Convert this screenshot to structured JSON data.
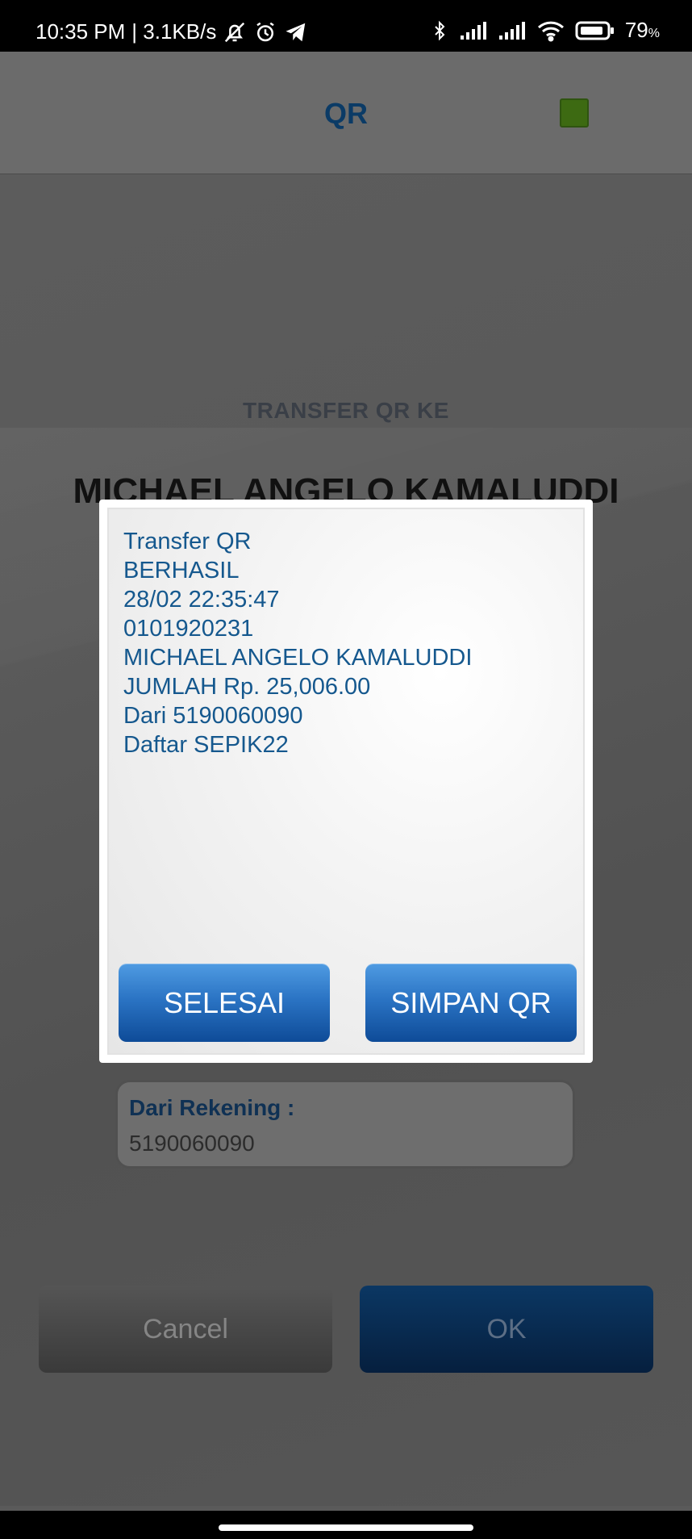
{
  "status_bar": {
    "time": "10:35 PM",
    "network_speed": "| 3.1KB/s",
    "battery_level": "79",
    "battery_unit": "%"
  },
  "header": {
    "title": "QR",
    "indicator_color": "#3d6a12"
  },
  "background": {
    "transfer_to_label": "TRANSFER QR KE",
    "recipient_name": "MICHAEL ANGELO KAMALUDDI",
    "from_account_label": "Dari Rekening :",
    "from_account_value": "5190060090",
    "cancel_label": "Cancel",
    "ok_label": "OK"
  },
  "dialog": {
    "lines": [
      "Transfer QR",
      "BERHASIL",
      "28/02 22:35:47",
      "0101920231",
      "MICHAEL ANGELO KAMALUDDI",
      "JUMLAH Rp. 25,006.00",
      "Dari 5190060090",
      "Daftar SEPIK22"
    ],
    "done_label": "SELESAI",
    "save_qr_label": "SIMPAN QR"
  },
  "icons": {
    "silent": "bell-off-icon",
    "alarm": "alarm-clock-icon",
    "telegram": "telegram-icon",
    "bluetooth": "bluetooth-icon",
    "signal": "cell-signal-icon",
    "wifi": "wifi-icon",
    "battery": "battery-icon"
  },
  "colors": {
    "accent_blue": "#15588e",
    "title_blue": "#0b3b66",
    "button_blue": "#2b74c4"
  }
}
